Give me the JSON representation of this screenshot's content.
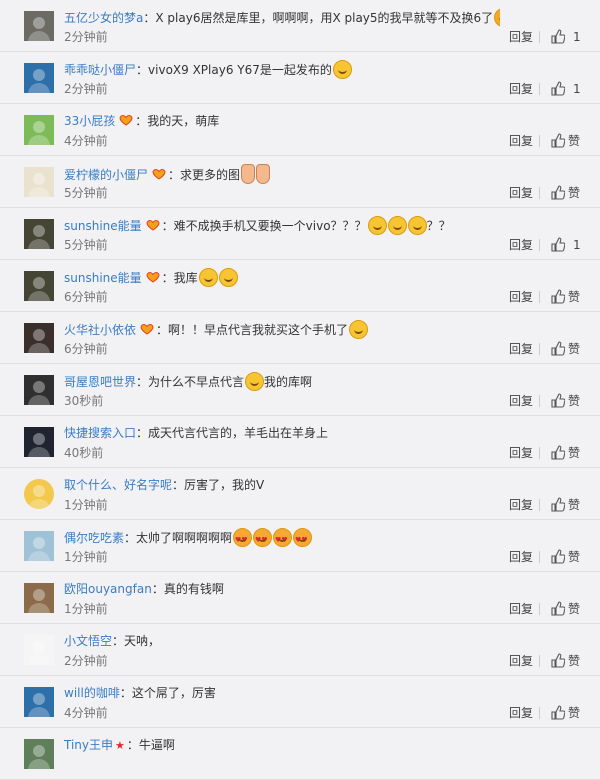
{
  "ui": {
    "reply_label": "回复"
  },
  "comments": [
    {
      "user": "五亿少女的梦a",
      "text": "X play6居然是库里，啊啊啊，用X play5的我早就等不及换6了",
      "emojis": [
        "laugh",
        "laugh"
      ],
      "time": "2分钟前",
      "likes": "1",
      "vip": false,
      "avatar": "#6b6b64"
    },
    {
      "user": "乖乖哒小僵尸",
      "text": "vivoX9 XPlay6 Y67是一起发布的",
      "emojis": [
        "calm"
      ],
      "time": "2分钟前",
      "likes": "1",
      "vip": false,
      "avatar": "#2d6fa8"
    },
    {
      "user": "33小屁孩",
      "text": "我的天，萌库",
      "emojis": [],
      "time": "4分钟前",
      "likes": "赞",
      "vip": true,
      "avatar": "#7dbb58"
    },
    {
      "user": "爱柠檬的小僵尸",
      "text": "求更多的图",
      "emojis": [
        "hand",
        "hand"
      ],
      "time": "5分钟前",
      "likes": "赞",
      "vip": true,
      "avatar": "#e8e2cf"
    },
    {
      "user": "sunshine能量",
      "text": "难不成换手机又要换一个vivo？？？",
      "emojis": [
        "calm",
        "calm",
        "calm"
      ],
      "text_after": "？？",
      "time": "5分钟前",
      "likes": "1",
      "vip": true,
      "avatar": "#454536"
    },
    {
      "user": "sunshine能量",
      "text": "我库",
      "emojis": [
        "calm",
        "calm"
      ],
      "time": "6分钟前",
      "likes": "赞",
      "vip": true,
      "avatar": "#454536"
    },
    {
      "user": "火华社小依依",
      "text": "啊！！早点代言我就买这个手机了",
      "emojis": [
        "calm"
      ],
      "time": "6分钟前",
      "likes": "赞",
      "vip": true,
      "avatar": "#3a2f2a"
    },
    {
      "user": "哥屋恩吧世界",
      "text": "为什么不早点代言",
      "emojis": [
        "cry"
      ],
      "text_after": "我的库啊",
      "time": "30秒前",
      "likes": "赞",
      "vip": false,
      "avatar": "#2f2f2f"
    },
    {
      "user": "快捷搜索入口",
      "text": "成天代言代言的，羊毛出在羊身上",
      "emojis": [],
      "time": "40秒前",
      "likes": "赞",
      "vip": false,
      "avatar": "#1f2430"
    },
    {
      "user": "取个什么、好名字呢",
      "text": "厉害了，我的V",
      "emojis": [],
      "time": "1分钟前",
      "likes": "赞",
      "vip": false,
      "avatar": "#f2c94c"
    },
    {
      "user": "偶尔吃吃素",
      "text": "太帅了啊啊啊啊啊",
      "emojis": [
        "heart",
        "heart",
        "heart",
        "heart"
      ],
      "time": "1分钟前",
      "likes": "赞",
      "vip": false,
      "avatar": "#9fc2d6"
    },
    {
      "user": "欧阳ouyangfan",
      "text": "真的有钱啊",
      "emojis": [],
      "time": "1分钟前",
      "likes": "赞",
      "vip": false,
      "avatar": "#8b6b4a"
    },
    {
      "user": "小文悟空",
      "text": "天呐，",
      "emojis": [],
      "time": "2分钟前",
      "likes": "赞",
      "vip": false,
      "avatar": "#f5f5f5"
    },
    {
      "user": "will的咖啡",
      "text": "这个屌了，厉害",
      "emojis": [],
      "time": "4分钟前",
      "likes": "赞",
      "vip": false,
      "avatar": "#2d6fa8"
    },
    {
      "user": "Tiny王申",
      "text": "牛逼啊",
      "emojis": [],
      "time": "",
      "likes": "",
      "vip": false,
      "star": true,
      "avatar": "#5f7f5a"
    }
  ]
}
